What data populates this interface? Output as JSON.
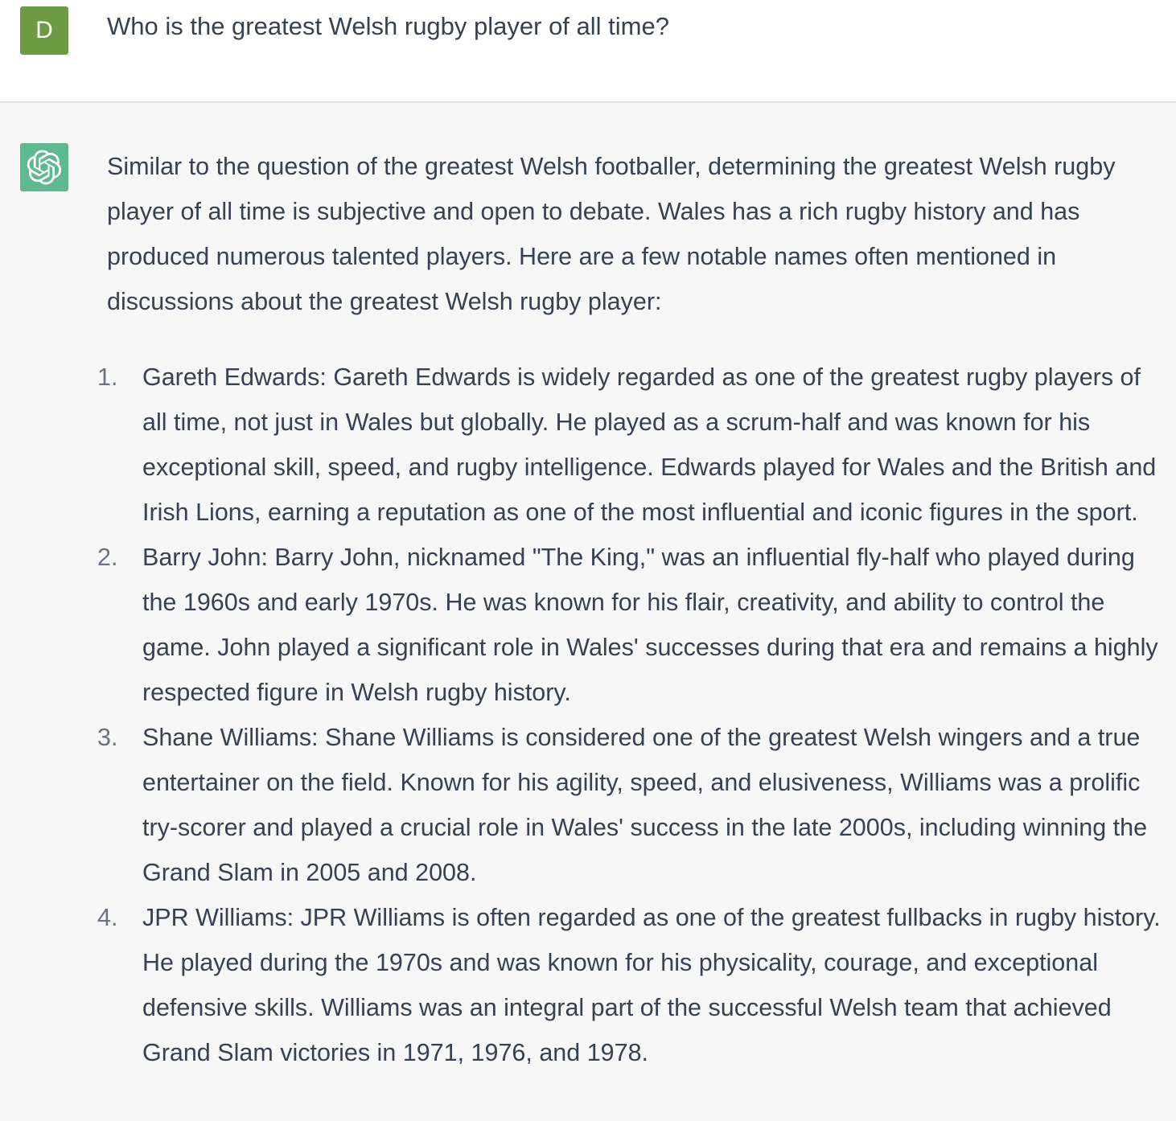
{
  "user_message": {
    "avatar_letter": "D",
    "text": "Who is the greatest Welsh rugby player of all time?"
  },
  "assistant_message": {
    "avatar_icon": "openai-logo-icon",
    "intro": "Similar to the question of the greatest Welsh footballer, determining the greatest Welsh rugby player of all time is subjective and open to debate. Wales has a rich rugby history and has produced numerous talented players. Here are a few notable names often mentioned in discussions about the greatest Welsh rugby player:",
    "items": [
      {
        "number": "1.",
        "text": "Gareth Edwards: Gareth Edwards is widely regarded as one of the greatest rugby players of all time, not just in Wales but globally. He played as a scrum-half and was known for his exceptional skill, speed, and rugby intelligence. Edwards played for Wales and the British and Irish Lions, earning a reputation as one of the most influential and iconic figures in the sport."
      },
      {
        "number": "2.",
        "text": "Barry John: Barry John, nicknamed \"The King,\" was an influential fly-half who played during the 1960s and early 1970s. He was known for his flair, creativity, and ability to control the game. John played a significant role in Wales' successes during that era and remains a highly respected figure in Welsh rugby history."
      },
      {
        "number": "3.",
        "text": "Shane Williams: Shane Williams is considered one of the greatest Welsh wingers and a true entertainer on the field. Known for his agility, speed, and elusiveness, Williams was a prolific try-scorer and played a crucial role in Wales' success in the late 2000s, including winning the Grand Slam in 2005 and 2008."
      },
      {
        "number": "4.",
        "text": "JPR Williams: JPR Williams is often regarded as one of the greatest fullbacks in rugby history. He played during the 1970s and was known for his physicality, courage, and exceptional defensive skills. Williams was an integral part of the successful Welsh team that achieved Grand Slam victories in 1971, 1976, and 1978."
      }
    ]
  },
  "colors": {
    "user_avatar_bg": "#6e9a43",
    "bot_avatar_bg": "#5fb98f",
    "assistant_row_bg": "#f7f7f8",
    "text": "#374151"
  }
}
